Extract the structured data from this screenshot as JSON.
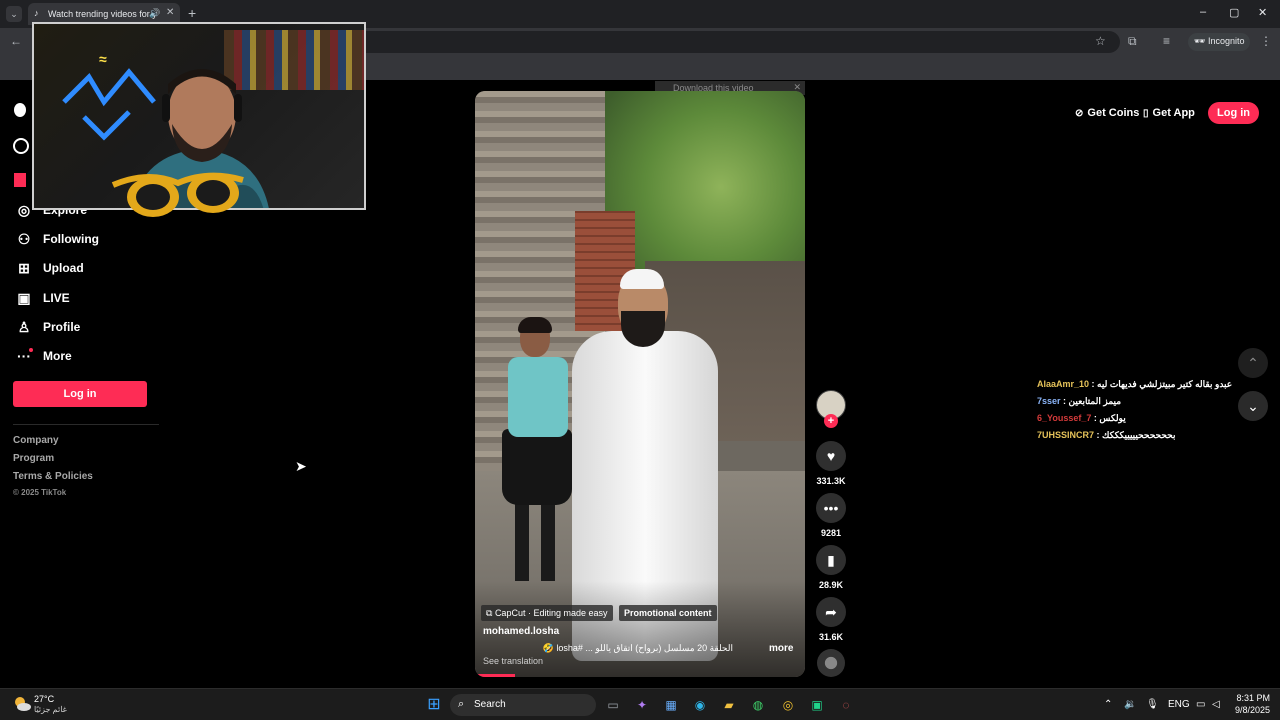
{
  "browser": {
    "tab_title": "Watch trending videos for y",
    "incognito_label": "Incognito"
  },
  "sidebar": {
    "items": [
      {
        "label": "Explore",
        "icon": "compass-icon"
      },
      {
        "label": "Following",
        "icon": "following-icon"
      },
      {
        "label": "Upload",
        "icon": "upload-icon"
      },
      {
        "label": "LIVE",
        "icon": "live-icon"
      },
      {
        "label": "Profile",
        "icon": "profile-icon"
      },
      {
        "label": "More",
        "icon": "more-icon"
      }
    ],
    "login_label": "Log in",
    "footer": [
      "Company",
      "Program",
      "Terms & Policies"
    ],
    "copyright": "© 2025 TikTok"
  },
  "header": {
    "get_coins": "Get Coins",
    "get_app": "Get App",
    "login": "Log in"
  },
  "download_bar": "Download this video",
  "video": {
    "capcut_tag": "CapCut · Editing made easy",
    "promo_tag": "Promotional content",
    "author": "mohamed.losha",
    "caption": "الحلقة 20 مسلسل (برواح) اتقاق ياللو ... #losha 🤣",
    "more": "more",
    "see_translation": "See translation",
    "progress": 0.12
  },
  "actions": {
    "likes": "331.3K",
    "comments": "9281",
    "saves": "28.9K",
    "shares": "31.6K"
  },
  "chat": [
    {
      "user": "AlaaAmr_10",
      "message": "عبدو بقاله كتير مبيتزلشي فديهات ليه",
      "color": "#e6c35a"
    },
    {
      "user": "7sser",
      "message": "ميمز المتابعين",
      "color": "#8ab4f8"
    },
    {
      "user": "6_Youssef_7",
      "message": "يولكس",
      "color": "#d33a3a"
    },
    {
      "user": "7UHSSINCR7",
      "message": "بححححححيييييكككك",
      "color": "#e6c35a"
    }
  ],
  "taskbar": {
    "temp": "27°C",
    "weather_desc": "غائم جزئيًا",
    "search_label": "Search",
    "lang": "ENG",
    "time": "8:31 PM",
    "date": "9/8/2025"
  },
  "colors": {
    "accent": "#fe2c55",
    "chat_user": "#e6c35a"
  }
}
